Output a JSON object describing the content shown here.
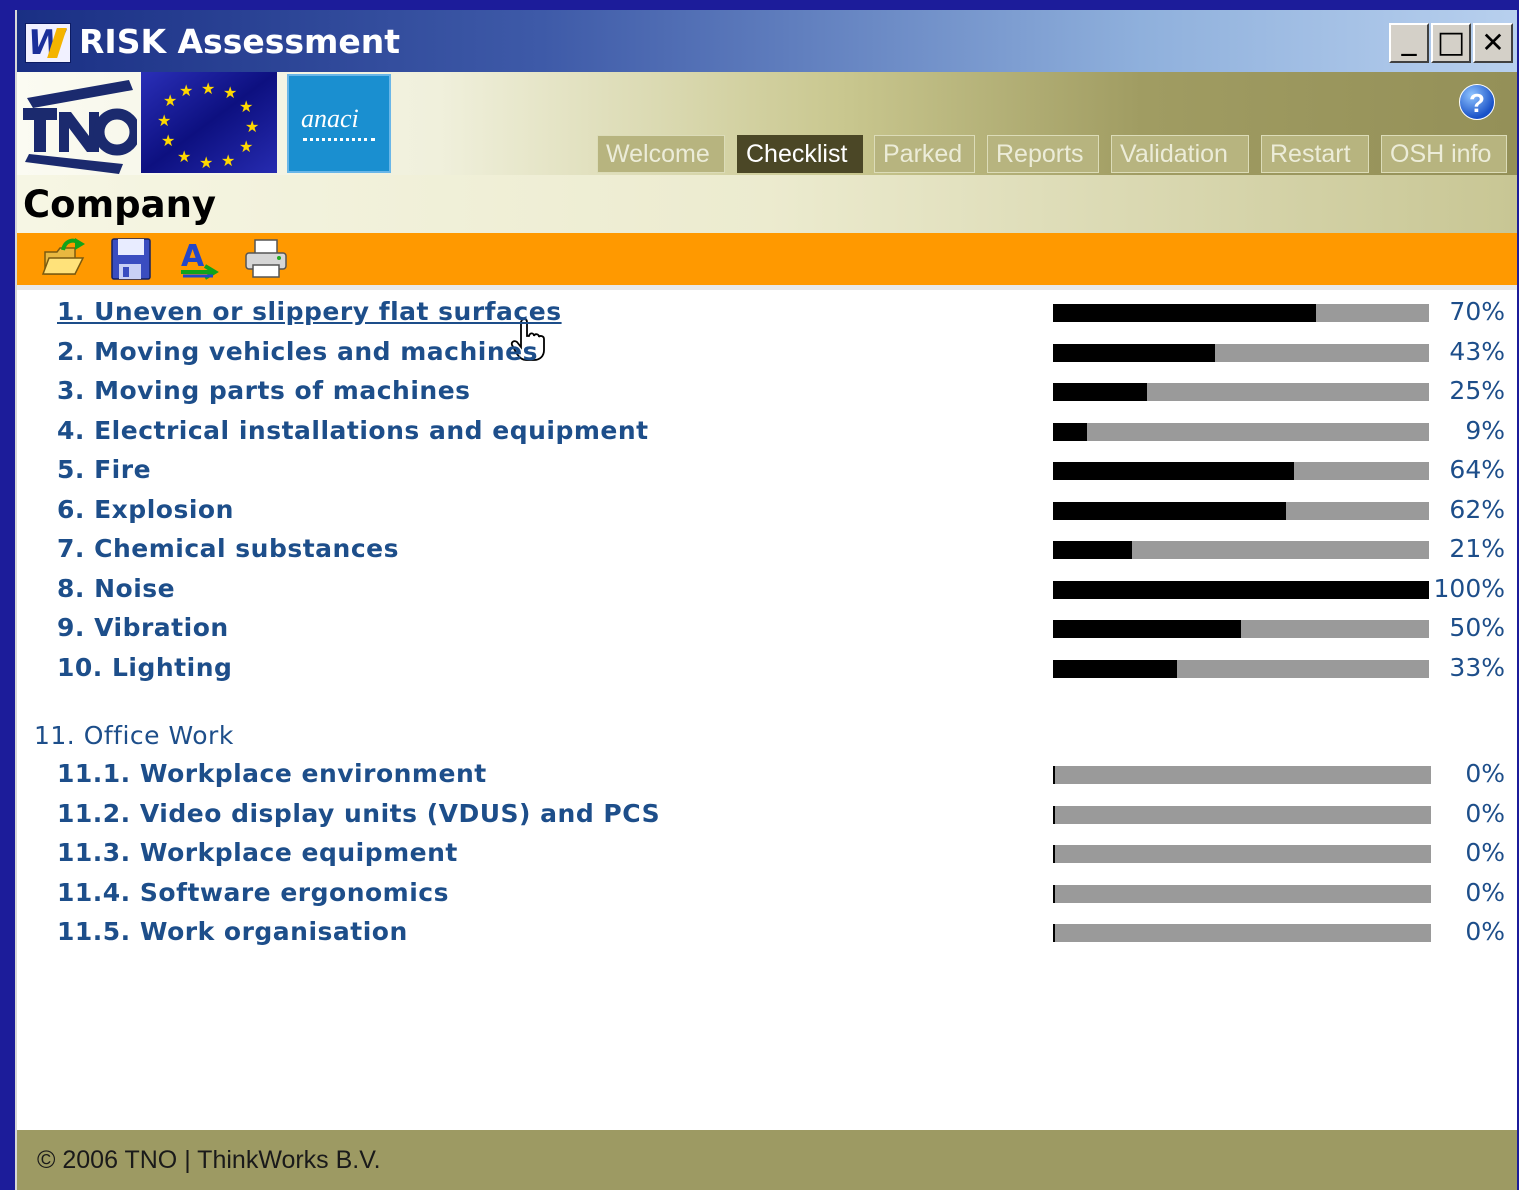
{
  "window": {
    "title": "RISK Assessment",
    "controls": {
      "minimize": "_",
      "maximize": "□",
      "close": "✕"
    }
  },
  "logos": {
    "partner": "anaci"
  },
  "header": {
    "tabs": [
      {
        "label": "Welcome",
        "active": false
      },
      {
        "label": "Checklist",
        "active": true
      },
      {
        "label": "Parked",
        "active": false
      },
      {
        "label": "Reports",
        "active": false
      },
      {
        "label": "Validation",
        "active": false
      },
      {
        "label": "Restart",
        "active": false
      },
      {
        "label": "OSH info",
        "active": false
      }
    ],
    "help": "?"
  },
  "page": {
    "title": "Company"
  },
  "toolbar": {
    "icons": [
      "open-folder-icon",
      "save-icon",
      "spellcheck-icon",
      "print-icon"
    ]
  },
  "checklist": {
    "items": [
      {
        "label": "1. Uneven or slippery flat surfaces",
        "percent": 70,
        "percent_label": "70%"
      },
      {
        "label": "2. Moving vehicles and machines",
        "percent": 43,
        "percent_label": "43%"
      },
      {
        "label": "3. Moving parts of machines",
        "percent": 25,
        "percent_label": "25%"
      },
      {
        "label": "4. Electrical installations and equipment",
        "percent": 9,
        "percent_label": "9%"
      },
      {
        "label": "5. Fire",
        "percent": 64,
        "percent_label": "64%"
      },
      {
        "label": "6. Explosion",
        "percent": 62,
        "percent_label": "62%"
      },
      {
        "label": "7. Chemical substances",
        "percent": 21,
        "percent_label": "21%"
      },
      {
        "label": "8. Noise",
        "percent": 100,
        "percent_label": "100%"
      },
      {
        "label": "9. Vibration",
        "percent": 50,
        "percent_label": "50%"
      },
      {
        "label": "10. Lighting",
        "percent": 33,
        "percent_label": "33%"
      }
    ],
    "group": {
      "label": "11. Office Work",
      "items": [
        {
          "label": "11.1. Workplace environment",
          "percent": 0,
          "percent_label": "0%"
        },
        {
          "label": "11.2. Video display units (VDUS) and PCS",
          "percent": 0,
          "percent_label": "0%"
        },
        {
          "label": "11.3. Workplace equipment",
          "percent": 0,
          "percent_label": "0%"
        },
        {
          "label": "11.4. Software ergonomics",
          "percent": 0,
          "percent_label": "0%"
        },
        {
          "label": "11.5. Work organisation",
          "percent": 0,
          "percent_label": "0%"
        }
      ]
    }
  },
  "footer": {
    "text": "© 2006 TNO | ThinkWorks B.V."
  }
}
